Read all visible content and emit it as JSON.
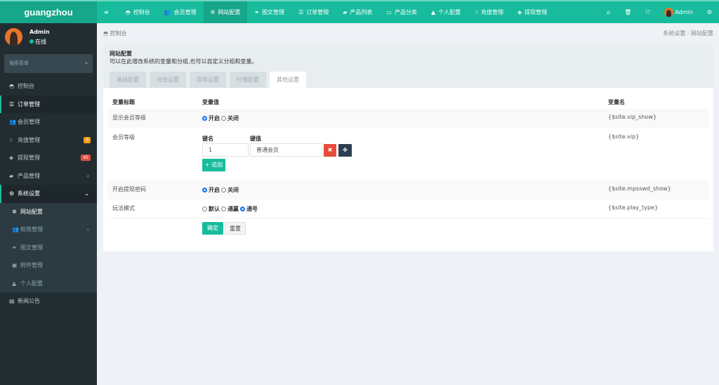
{
  "app": {
    "logo": "guangzhou"
  },
  "topnav": [
    {
      "icon": "menu-icon",
      "label": ""
    },
    {
      "icon": "dashboard-icon",
      "label": "控制台"
    },
    {
      "icon": "users-icon",
      "label": "会员管理"
    },
    {
      "icon": "gear-icon",
      "label": "网站配置",
      "active": true
    },
    {
      "icon": "leaf-icon",
      "label": "图文管理"
    },
    {
      "icon": "list-icon",
      "label": "订单管理"
    },
    {
      "icon": "shopping-bag-icon",
      "label": "产品列表"
    },
    {
      "icon": "card-icon",
      "label": "产品分类"
    },
    {
      "icon": "user-icon",
      "label": "个人配置"
    },
    {
      "icon": "hand-icon",
      "label": "充值管理"
    },
    {
      "icon": "tag-icon",
      "label": "提现管理"
    }
  ],
  "topright": {
    "user": "Admin"
  },
  "user": {
    "name": "Admin",
    "status": "在线"
  },
  "search": {
    "placeholder": "搜索菜单"
  },
  "sidebar": [
    {
      "icon": "dashboard-icon",
      "label": "控制台"
    },
    {
      "icon": "list-icon",
      "label": "订单管理",
      "active": true
    },
    {
      "icon": "users-icon",
      "label": "会员管理"
    },
    {
      "icon": "hand-icon",
      "label": "充值管理",
      "badge": "0",
      "badge_color": "#f39c12"
    },
    {
      "icon": "tag-icon",
      "label": "提现管理",
      "badge": "45",
      "badge_color": "#e74c3c"
    },
    {
      "icon": "shopping-bag-icon",
      "label": "产品管理",
      "arrow": "‹"
    },
    {
      "icon": "gears-icon",
      "label": "系统设置",
      "arrow": "⌄",
      "active": true
    }
  ],
  "submenu": [
    {
      "icon": "gear-icon",
      "label": "网站配置",
      "current": true
    },
    {
      "icon": "users-icon",
      "label": "权限管理",
      "arrow": "‹"
    },
    {
      "icon": "leaf-icon",
      "label": "图文管理"
    },
    {
      "icon": "file-image-icon",
      "label": "附件管理"
    },
    {
      "icon": "user-icon",
      "label": "个人配置"
    }
  ],
  "sidebar_last": {
    "icon": "newspaper-icon",
    "label": "新闻公告"
  },
  "breadcrumb": {
    "home": "控制台",
    "path": [
      "系统设置",
      "网站配置"
    ]
  },
  "panel": {
    "title": "网站配置",
    "desc": "可以在此增改系统的变量和分组,也可以自定义分组和变量。",
    "tabs": [
      "基础配置",
      "充值设置",
      "提现设置",
      "行情配置",
      "其他设置"
    ],
    "active_tab": "其他设置"
  },
  "table": {
    "headers": [
      "变量标题",
      "变量值",
      "变量名"
    ],
    "rows": [
      {
        "title": "显示会员等级",
        "options": [
          "开启",
          "关闭"
        ],
        "selected": "开启",
        "name": "{$site.vip_show}"
      },
      {
        "title": "会员等级",
        "key_label": "键名",
        "value_label": "键值",
        "key": "1",
        "value": "普通会员",
        "add_label": "追加",
        "name": "{$site.vip}"
      },
      {
        "title": "开启提现密码",
        "options": [
          "开启",
          "关闭"
        ],
        "selected": "开启",
        "name": "{$site.mpsswd_show}"
      },
      {
        "title": "玩法模式",
        "options": [
          "默认",
          "通赢",
          "通号"
        ],
        "selected": "通号",
        "name": "{$site.play_type}"
      }
    ]
  },
  "buttons": {
    "submit": "确定",
    "reset": "重置"
  },
  "colors": {
    "primary": "#18bc9c",
    "sidebar": "#222d32",
    "danger": "#e74c3c",
    "dark": "#2c3e50"
  }
}
